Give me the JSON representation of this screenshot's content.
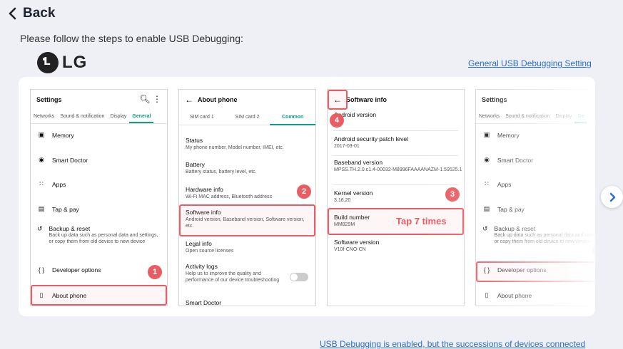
{
  "back_label": "Back",
  "instruction": "Please follow the steps to enable USB Debugging:",
  "brand": "LG",
  "general_link": "General USB Debugging Setting",
  "bottom_link": "USB Debugging is enabled, but the successions of devices connected",
  "tap_text": "Tap 7 times",
  "steps": [
    "1",
    "2",
    "3",
    "4"
  ],
  "screen1": {
    "title": "Settings",
    "tabs": [
      "Networks",
      "Sound & notification",
      "Display",
      "General"
    ],
    "memory": "Memory",
    "smart_doctor": "Smart Doctor",
    "apps": "Apps",
    "tap_pay": "Tap & pay",
    "backup_title": "Backup & reset",
    "backup_sub": "Back up data such as personal data and settings, or copy them from old device to new device",
    "developer": "Developer options",
    "about": "About phone"
  },
  "screen2": {
    "title": "About phone",
    "tabs": [
      "SIM card 1",
      "SIM card 2",
      "Common"
    ],
    "status_title": "Status",
    "status_sub": "My phone number, Model number, IMEI, etc.",
    "battery_title": "Battery",
    "battery_sub": "Battery status, battery level, etc.",
    "hardware_title": "Hardware info",
    "hardware_sub": "Wi-Fi MAC address, Bluetooth address",
    "software_title": "Software info",
    "software_sub": "Android version, Baseband version, Software version, etc.",
    "legal_title": "Legal info",
    "legal_sub": "Open source licenses",
    "activity_title": "Activity logs",
    "activity_sub": "Help us to improve the quality and performance of our device troubleshooting",
    "smart_doctor": "Smart Doctor"
  },
  "screen3": {
    "title": "Software info",
    "android_title": "Android version",
    "patch_title": "Android security patch level",
    "patch_val": "2017-03-01",
    "baseband_title": "Baseband version",
    "baseband_val": "MPSS.TH.2.0.c1.4-00032-M8996FAAAANAZM-1.59525.1",
    "kernel_title": "Kernel version",
    "kernel_val": "3.18.20",
    "build_title": "Build number",
    "build_val": "MM829M",
    "software_title": "Software version",
    "software_val": "V10f-CNO-CN"
  },
  "screen4": {
    "title": "Settings",
    "tabs": [
      "Networks",
      "Sound & notification",
      "Display",
      "Ge"
    ],
    "memory": "Memory",
    "smart_doctor": "Smart Doctor",
    "apps": "Apps",
    "tap_pay": "Tap & pay",
    "backup_title": "Backup & reset",
    "backup_sub": "Back up data such as personal data and settings, or copy them from old device to new device",
    "developer": "Developer options",
    "about": "About phone"
  }
}
